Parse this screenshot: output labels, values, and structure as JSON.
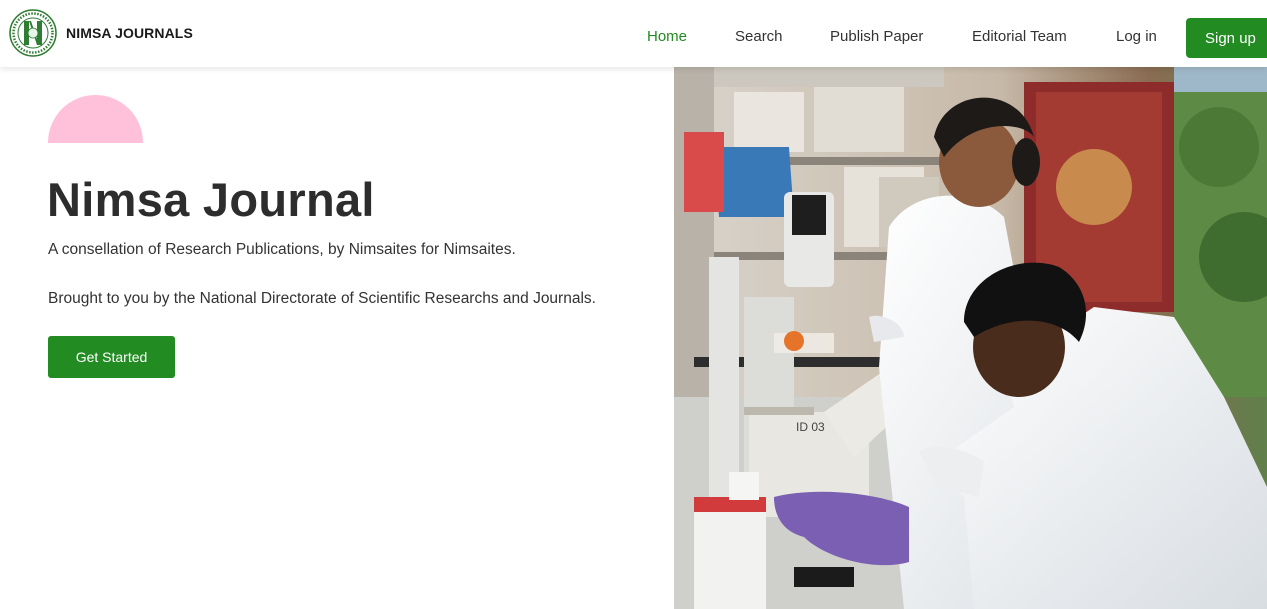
{
  "header": {
    "brand_name": "NIMSA JOURNALS",
    "logo_icon": "nimsa-seal-logo",
    "nav": [
      {
        "label": "Home",
        "active": true
      },
      {
        "label": "Search",
        "active": false
      },
      {
        "label": "Publish Paper",
        "active": false
      },
      {
        "label": "Editorial Team",
        "active": false
      },
      {
        "label": "Log in",
        "active": false
      }
    ],
    "signup_label": "Sign up"
  },
  "hero": {
    "title": "Nimsa Journal",
    "subtitle": "A consellation of Research Publications, by Nimsaites for Nimsaites.",
    "subtitle2": "Brought to you by the National Directorate of Scientific Researchs and Journals.",
    "cta_label": "Get Started",
    "microscope_label": "ID 03"
  },
  "colors": {
    "brand_green": "#228b22",
    "accent_pink": "#ffc0d9",
    "text_dark": "#2d2d2d"
  }
}
